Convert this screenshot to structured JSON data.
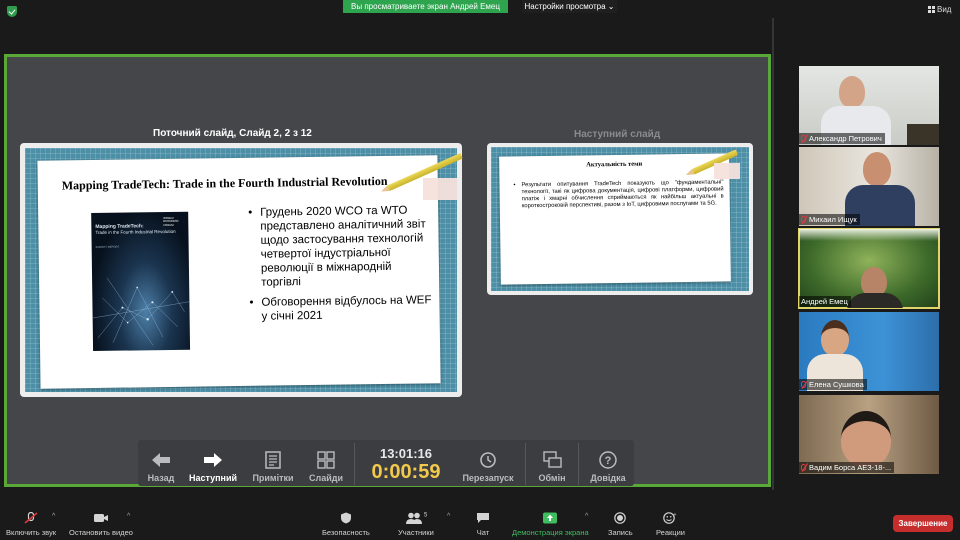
{
  "top_bar": {
    "share_banner": "Вы просматриваете экран Андрей Емец",
    "view_settings": "Настройки просмотра",
    "view_button": "Вид"
  },
  "presenter": {
    "current_label": "Поточний слайд, Слайд 2, 2 з 12",
    "next_label": "Наступний слайд",
    "current_slide": {
      "title": "Mapping TradeTech: Trade in the Fourth Industrial Revolution",
      "cover_title": "Mapping TradeTech:",
      "cover_subtitle": "Trade in the Fourth Industrial Revolution",
      "cover_org": "WORLD ECONOMIC FORUM",
      "cover_report": "INSIGHT REPORT",
      "bullets": [
        "Грудень 2020 WCO та WTO представлено аналітичний звіт щодо застосування технологій четвертої індустріальної революції в міжнародній торгівлі",
        "Обговорення відбулось на WEF у січні 2021"
      ]
    },
    "next_slide": {
      "title": "Актуальність теми",
      "text": "Результати опитування TradeTech показують що \"фундаментальні\" технології, такі як цифрова документація, цифрові платформи, цифровий платіж і хмарні обчислення сприймаються як найбільш актуальні в короткостроковій перспективі, разом з IoT, цифровими послугами та 5G."
    },
    "toolbar": {
      "back": "Назад",
      "next": "Наступний",
      "notes": "Примітки",
      "slides": "Слайди",
      "time": "13:01:16",
      "elapsed": "0:00:59",
      "restart": "Перезапуск",
      "swap": "Обмін",
      "help": "Довідка"
    }
  },
  "participants": [
    {
      "name": "Александр Петрович"
    },
    {
      "name": "Михаил Ищук"
    },
    {
      "name": "Андрей Емец"
    },
    {
      "name": "Елена Сушкова"
    },
    {
      "name": "Вадим Борса АЕЗ-18-..."
    }
  ],
  "bottom_bar": {
    "mute": "Включить звук",
    "video": "Остановить видео",
    "security": "Безопасность",
    "participants": "Участники",
    "participants_count": "5",
    "chat": "Чат",
    "share": "Демонстрация экрана",
    "record": "Запись",
    "reactions": "Реакции",
    "end": "Завершение"
  },
  "colors": {
    "share_green": "#2ea44f",
    "active_border": "#5aa837",
    "end_red": "#c62e2e",
    "timer_yellow": "#f2c94c"
  }
}
